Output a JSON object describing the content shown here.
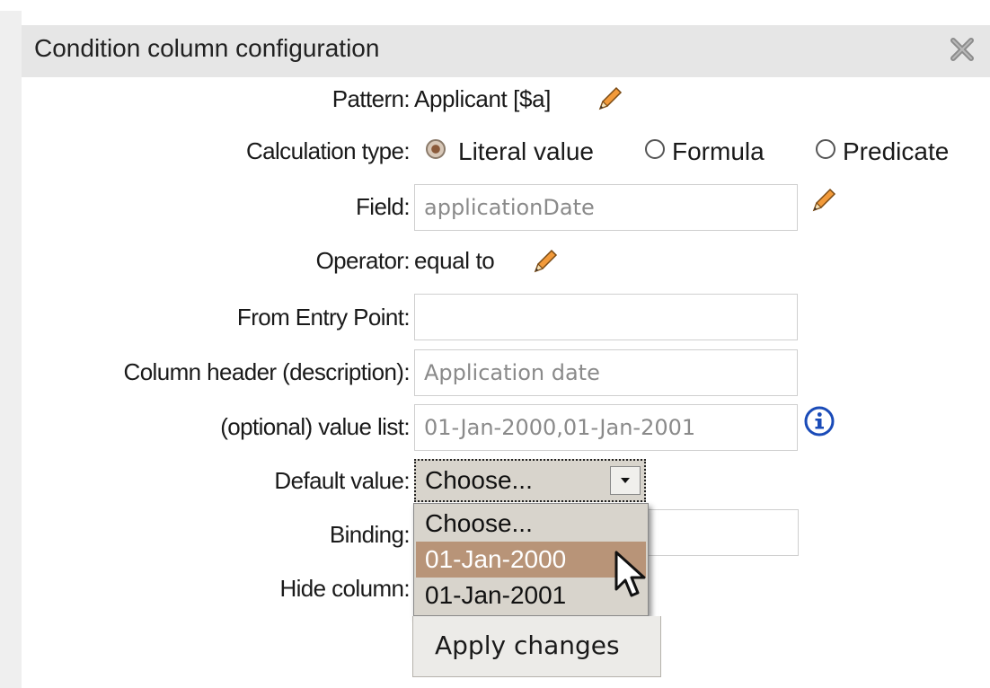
{
  "dialog": {
    "title": "Condition column configuration",
    "close_icon": "close-icon"
  },
  "form": {
    "pattern": {
      "label": "Pattern:",
      "value": "Applicant [$a]",
      "edit_icon": "pencil-icon"
    },
    "calculation_type": {
      "label": "Calculation type:",
      "options": [
        "Literal value",
        "Formula",
        "Predicate"
      ],
      "selected": "Literal value"
    },
    "field": {
      "label": "Field:",
      "value": "applicationDate",
      "edit_icon": "pencil-icon"
    },
    "operator": {
      "label": "Operator:",
      "value": "equal to",
      "edit_icon": "pencil-icon"
    },
    "from_entry_point": {
      "label": "From Entry Point:",
      "value": ""
    },
    "column_header": {
      "label": "Column header (description):",
      "value": "Application date"
    },
    "value_list": {
      "label": "(optional) value list:",
      "value": "01-Jan-2000,01-Jan-2001",
      "info_icon": "info-icon"
    },
    "default_value": {
      "label": "Default value:",
      "selected": "Choose...",
      "options": [
        "Choose...",
        "01-Jan-2000",
        "01-Jan-2001"
      ],
      "highlighted": "01-Jan-2000"
    },
    "binding": {
      "label": "Binding:",
      "value": ""
    },
    "hide_column": {
      "label": "Hide column:"
    },
    "apply_button": "Apply changes"
  },
  "colors": {
    "title_bar": "#e6e6e6",
    "highlight": "#b89478",
    "pencil": "#e07a1f",
    "info": "#1a4bb8"
  }
}
